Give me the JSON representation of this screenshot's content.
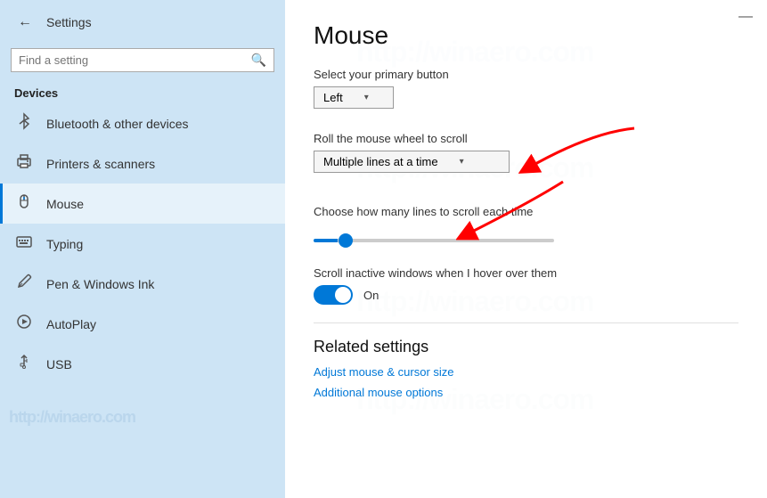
{
  "sidebar": {
    "back_icon": "←",
    "settings_label": "Settings",
    "search_placeholder": "Find a setting",
    "search_icon": "🔍",
    "section_label": "Devices",
    "nav_items": [
      {
        "id": "bluetooth",
        "label": "Bluetooth & other devices",
        "icon": "⬡",
        "active": false
      },
      {
        "id": "printers",
        "label": "Printers & scanners",
        "icon": "🖨",
        "active": false
      },
      {
        "id": "mouse",
        "label": "Mouse",
        "icon": "🖱",
        "active": true
      },
      {
        "id": "typing",
        "label": "Typing",
        "icon": "⌨",
        "active": false
      },
      {
        "id": "pen",
        "label": "Pen & Windows Ink",
        "icon": "✒",
        "active": false
      },
      {
        "id": "autoplay",
        "label": "AutoPlay",
        "icon": "▶",
        "active": false
      },
      {
        "id": "usb",
        "label": "USB",
        "icon": "⚡",
        "active": false
      }
    ],
    "watermark": "http://winaero.com"
  },
  "main": {
    "title": "Mouse",
    "minimize_btn": "—",
    "settings": {
      "primary_button_label": "Select your primary button",
      "primary_button_value": "Left",
      "scroll_label": "Roll the mouse wheel to scroll",
      "scroll_value": "Multiple lines at a time",
      "lines_label": "Choose how many lines to scroll each time",
      "inactive_scroll_label": "Scroll inactive windows when I hover over them",
      "toggle_value": "On"
    },
    "related": {
      "title": "Related settings",
      "links": [
        "Adjust mouse & cursor size",
        "Additional mouse options"
      ]
    },
    "watermark": "http://winaero.com"
  }
}
